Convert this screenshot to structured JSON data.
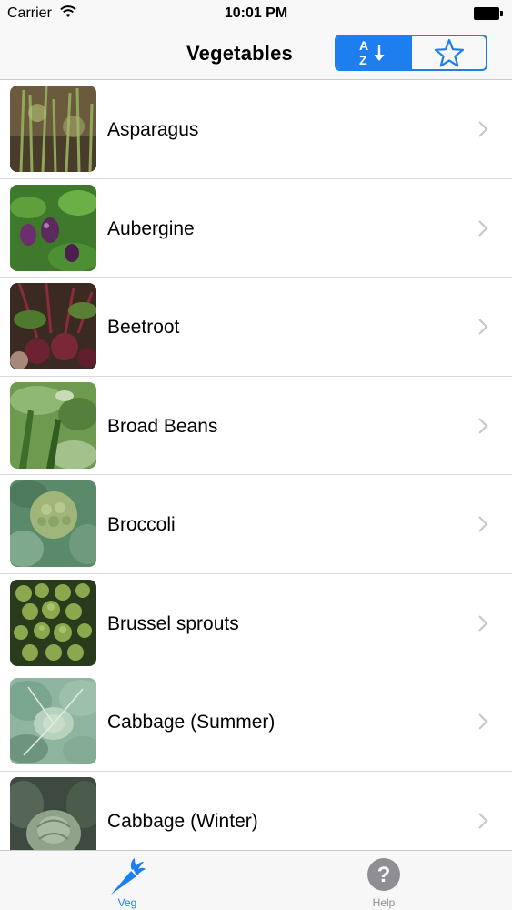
{
  "status_bar": {
    "carrier": "Carrier",
    "time": "10:01 PM"
  },
  "nav": {
    "title": "Vegetables",
    "segments": [
      {
        "name": "sort-az",
        "selected": true
      },
      {
        "name": "favorites",
        "selected": false
      }
    ]
  },
  "list": {
    "items": [
      {
        "label": "Asparagus",
        "image": "asparagus-photo"
      },
      {
        "label": "Aubergine",
        "image": "aubergine-photo"
      },
      {
        "label": "Beetroot",
        "image": "beetroot-photo"
      },
      {
        "label": "Broad Beans",
        "image": "broad-beans-photo"
      },
      {
        "label": "Broccoli",
        "image": "broccoli-photo"
      },
      {
        "label": "Brussel sprouts",
        "image": "brussel-sprouts-photo"
      },
      {
        "label": "Cabbage (Summer)",
        "image": "cabbage-summer-photo"
      },
      {
        "label": "Cabbage (Winter)",
        "image": "cabbage-winter-photo"
      }
    ]
  },
  "tab_bar": {
    "tabs": [
      {
        "label": "Veg",
        "icon": "carrot-icon",
        "selected": true
      },
      {
        "label": "Help",
        "icon": "question-icon",
        "selected": false
      }
    ]
  },
  "colors": {
    "accent": "#1d7ef0",
    "separator": "#dadada",
    "chevron": "#c7c7cc",
    "inactive_tab": "#8e8e93"
  }
}
